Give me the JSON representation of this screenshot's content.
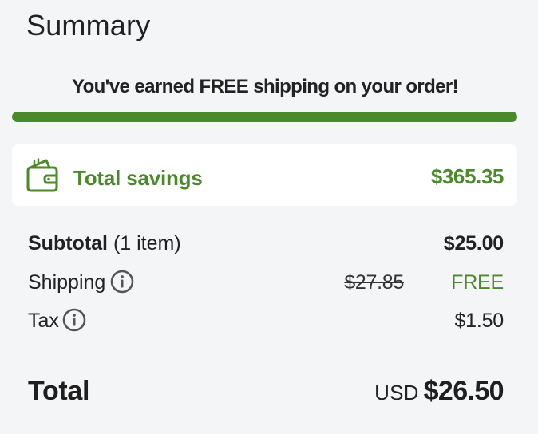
{
  "summary": {
    "title": "Summary"
  },
  "shipping_promo": {
    "message": "You've earned FREE shipping on your order!",
    "progress_fraction": 1.0,
    "color": "#4a8a2a"
  },
  "savings": {
    "icon": "wallet-icon",
    "label": "Total savings",
    "value": "$365.35",
    "color": "#4a8a2a"
  },
  "lines": {
    "subtotal": {
      "label": "Subtotal",
      "count": " (1 item)",
      "value": "$25.00"
    },
    "shipping": {
      "label": "Shipping",
      "info_icon": "info-icon",
      "original_value": "$27.85",
      "value": "FREE"
    },
    "tax": {
      "label": "Tax",
      "info_icon": "info-icon",
      "value": "$1.50"
    }
  },
  "total": {
    "label": "Total",
    "currency": "USD",
    "value": "$26.50"
  }
}
